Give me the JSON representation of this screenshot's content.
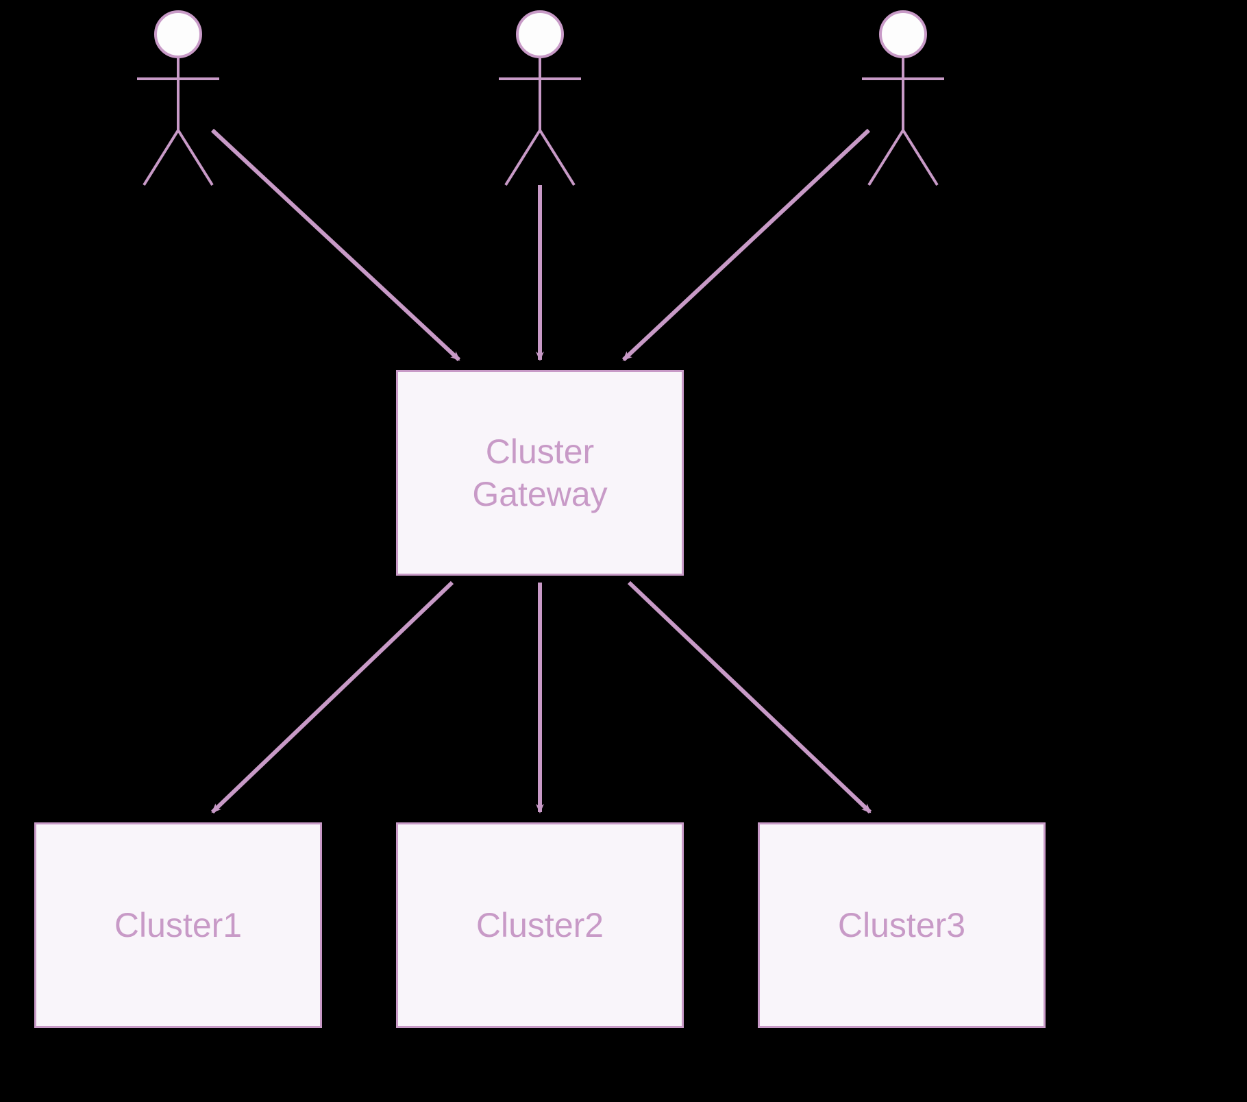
{
  "colors": {
    "background": "#000000",
    "nodeFill": "#f9f5fa",
    "nodeBorder": "#c89ac7",
    "text": "#c89ac7",
    "arrow": "#c89ac7"
  },
  "actors": {
    "count": 3
  },
  "nodes": {
    "gateway": {
      "label": "Cluster\nGateway"
    },
    "cluster1": {
      "label": "Cluster1"
    },
    "cluster2": {
      "label": "Cluster2"
    },
    "cluster3": {
      "label": "Cluster3"
    }
  }
}
